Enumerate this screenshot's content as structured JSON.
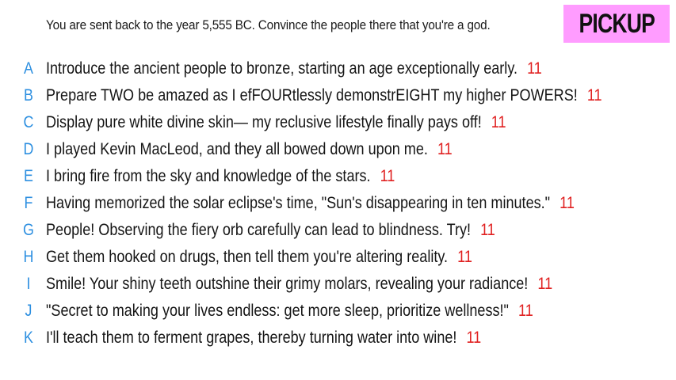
{
  "header": {
    "prompt": "You are sent back to the year 5,555 BC. Convince the people there that you're a god.",
    "badge": "PICKUP",
    "badge_color": "#ff9cff"
  },
  "colors": {
    "letter": "#2d8fe0",
    "score": "#e02020",
    "text": "#151515"
  },
  "answers": [
    {
      "letter": "A",
      "text": "Introduce the ancient people to bronze, starting an age exceptionally early.",
      "score": "11"
    },
    {
      "letter": "B",
      "text": "Prepare TWO be amazed as I efFOURtlessly demonstrEIGHT my higher POWERS!",
      "score": "11"
    },
    {
      "letter": "C",
      "text": "Display pure white divine skin— my reclusive lifestyle finally pays off!",
      "score": "11"
    },
    {
      "letter": "D",
      "text": "I played Kevin MacLeod, and they all bowed down upon me.",
      "score": "11"
    },
    {
      "letter": "E",
      "text": "I bring fire from the sky and knowledge of the stars.",
      "score": "11"
    },
    {
      "letter": "F",
      "text": "Having memorized the solar eclipse's time, \"Sun's disappearing in ten minutes.\"",
      "score": "11"
    },
    {
      "letter": "G",
      "text": "People! Observing the fiery orb carefully can lead to blindness. Try!",
      "score": "11"
    },
    {
      "letter": "H",
      "text": "Get them hooked on drugs, then tell them you're altering reality.",
      "score": "11"
    },
    {
      "letter": "I",
      "text": "Smile! Your shiny teeth outshine their grimy molars, revealing your radiance!",
      "score": "11"
    },
    {
      "letter": "J",
      "text": "\"Secret to making your lives endless: get more sleep, prioritize wellness!\"",
      "score": "11"
    },
    {
      "letter": "K",
      "text": "I'll teach them to ferment grapes, thereby turning water into wine!",
      "score": "11"
    }
  ]
}
